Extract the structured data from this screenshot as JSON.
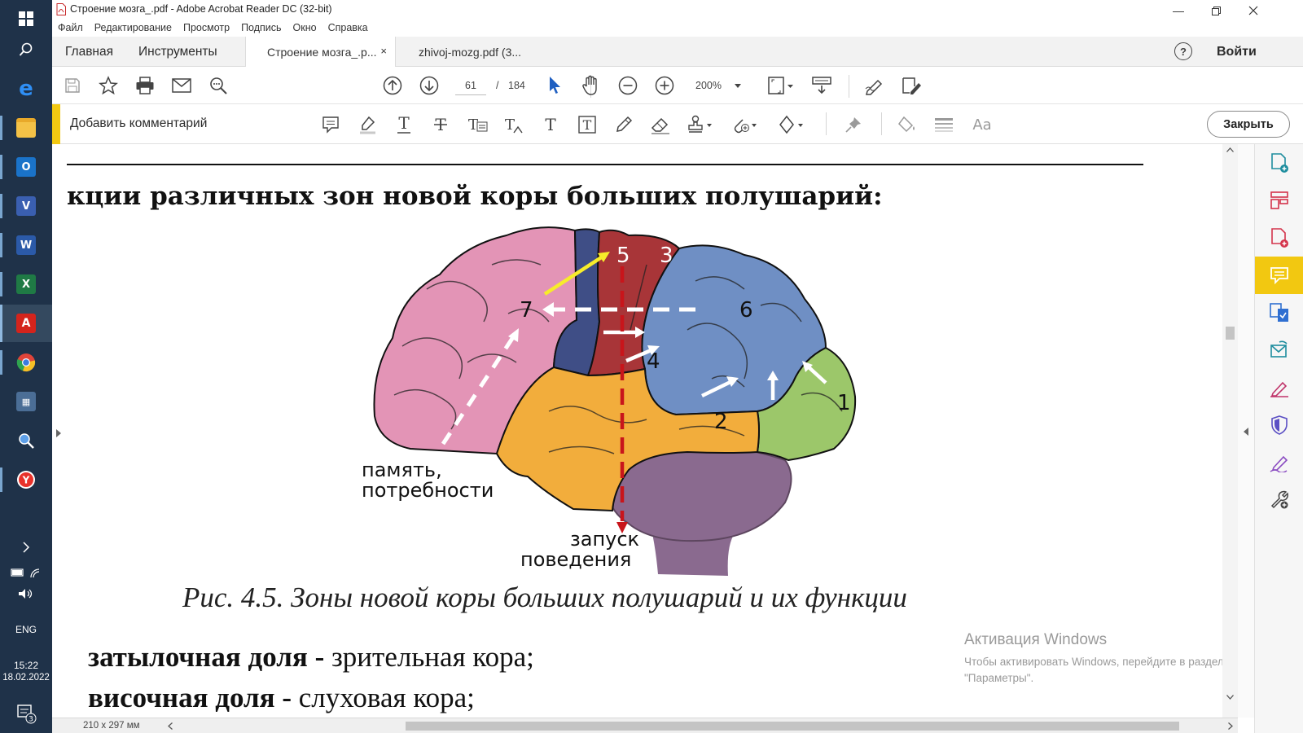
{
  "window": {
    "title": "Строение мозга_.pdf - Adobe Acrobat Reader DC (32-bit)"
  },
  "menu": [
    "Файл",
    "Редактирование",
    "Просмотр",
    "Подпись",
    "Окно",
    "Справка"
  ],
  "tabs": {
    "home": "Главная",
    "tools": "Инструменты",
    "docs": [
      "Строение мозга_.р...",
      "zhivoj-mozg.pdf (3..."
    ],
    "close_symbol": "×",
    "help": "?",
    "signin": "Войти"
  },
  "toolbar": {
    "page_current": "61",
    "page_separator": "/",
    "page_total": "184",
    "zoom": "200%"
  },
  "comment_bar": {
    "title": "Добавить комментарий",
    "close_label": "Закрыть"
  },
  "document": {
    "heading": "кции различных зон новой коры больших полушарий:",
    "figure_labels": {
      "z1": "1",
      "z2": "2",
      "z3": "3",
      "z4": "4",
      "z5": "5",
      "z6": "6",
      "z7": "7",
      "memory_1": "память,",
      "memory_2": "потребности",
      "launch_1": "запуск",
      "launch_2": "поведения"
    },
    "caption": "Рис. 4.5. Зоны новой коры больших полушарий и их функции",
    "lines": [
      {
        "term": "затылочная доля",
        "dash": " - ",
        "desc": "зрительная кора;"
      },
      {
        "term": "височная доля",
        "dash": " - ",
        "desc": "слуховая кора;"
      }
    ],
    "page_size": "210 x 297 мм"
  },
  "activation": {
    "title": "Активация Windows",
    "line1": "Чтобы активировать Windows, перейдите в раздел",
    "line2": "\"Параметры\"."
  },
  "taskbar": {
    "language": "ENG",
    "time": "15:22",
    "date": "18.02.2022",
    "notifications": "3"
  },
  "colors": {
    "accent_yellow": "#f2c811",
    "taskbar": "#1f3249",
    "zone_frontal": "#e394b6",
    "zone_premotor": "#3f4e86",
    "zone_motor": "#a83538",
    "zone_parietal": "#6f8fc4",
    "zone_temporal": "#f2ad3c",
    "zone_occipital": "#9cc76a",
    "zone_cerebellum": "#8a6a8f"
  }
}
